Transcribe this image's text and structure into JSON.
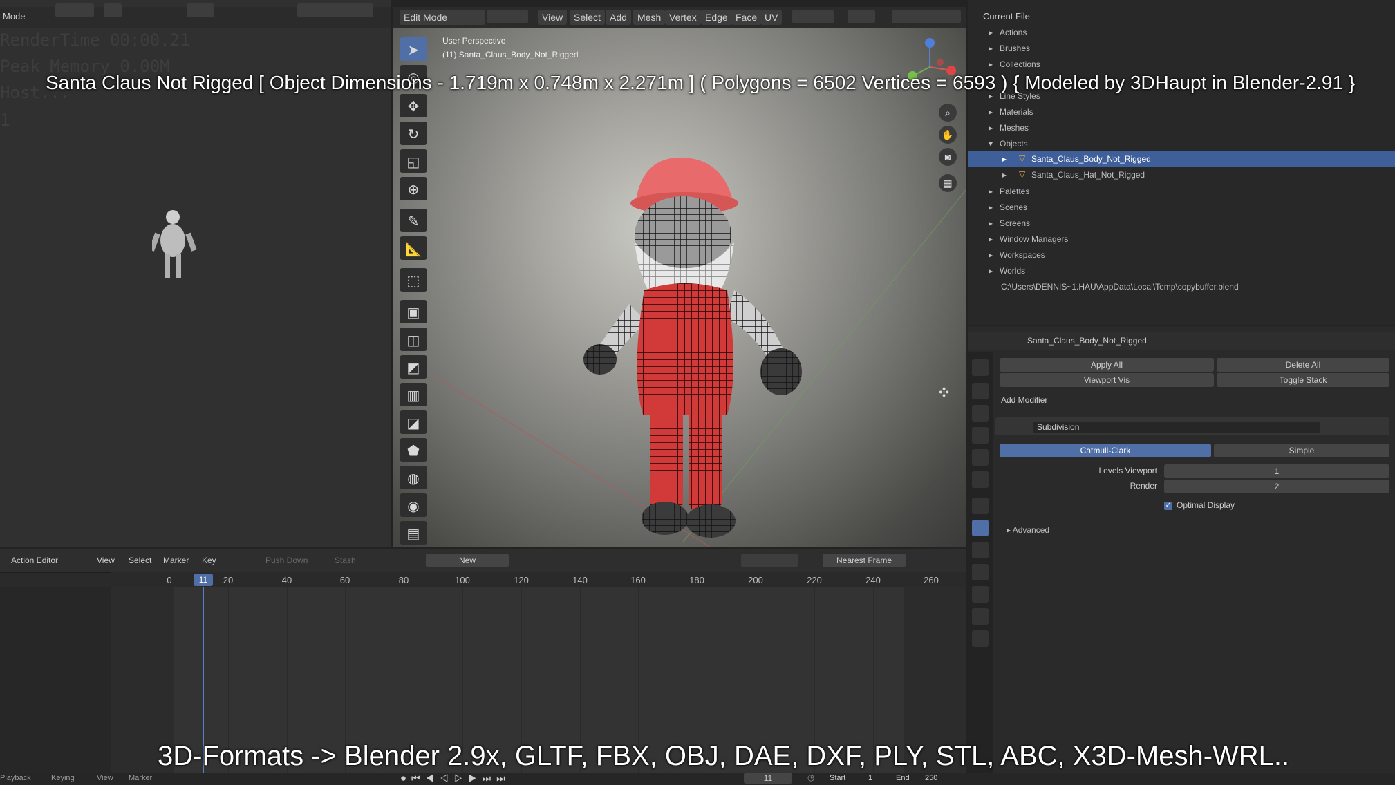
{
  "left_panel": {
    "mode_label": "Mode",
    "stats": [
      "RenderTime 00:00.21",
      "Peak Memory 0.00M",
      "Host..."
    ],
    "stat_index": "1"
  },
  "viewport": {
    "mode": "Edit Mode",
    "menus": [
      "View",
      "Select",
      "Add",
      "Mesh",
      "Vertex",
      "Edge",
      "Face",
      "UV"
    ],
    "perspective": "User Perspective",
    "object": "(11) Santa_Claus_Body_Not_Rigged"
  },
  "outliner": {
    "root": "Current File",
    "items": [
      {
        "label": "Actions",
        "indent": 1
      },
      {
        "label": "Brushes",
        "indent": 1
      },
      {
        "label": "Collections",
        "indent": 1
      },
      {
        "label": "Line Styles",
        "indent": 1
      },
      {
        "label": "Materials",
        "indent": 1
      },
      {
        "label": "Meshes",
        "indent": 1
      },
      {
        "label": "Objects",
        "indent": 1
      },
      {
        "label": "Santa_Claus_Body_Not_Rigged",
        "indent": 2,
        "selected": true
      },
      {
        "label": "Santa_Claus_Hat_Not_Rigged",
        "indent": 2
      },
      {
        "label": "Palettes",
        "indent": 1
      },
      {
        "label": "Scenes",
        "indent": 1
      },
      {
        "label": "Screens",
        "indent": 1
      },
      {
        "label": "Window Managers",
        "indent": 1
      },
      {
        "label": "Workspaces",
        "indent": 1
      },
      {
        "label": "Worlds",
        "indent": 1
      }
    ],
    "path": "C:\\Users\\DENNIS~1.HAU\\AppData\\Local\\Temp\\copybuffer.blend"
  },
  "properties": {
    "object_name": "Santa_Claus_Body_Not_Rigged",
    "apply_all": "Apply All",
    "delete_all": "Delete All",
    "viewport_vis": "Viewport Vis",
    "toggle_stack": "Toggle Stack",
    "add_modifier": "Add Modifier",
    "modifier_name": "Subdivision",
    "catmull": "Catmull-Clark",
    "simple": "Simple",
    "levels_viewport_label": "Levels Viewport",
    "levels_viewport_value": "1",
    "render_label": "Render",
    "render_value": "2",
    "optimal_display": "Optimal Display",
    "advanced": "Advanced"
  },
  "timeline": {
    "editor": "Action Editor",
    "menus": [
      "View",
      "Select",
      "Marker",
      "Key"
    ],
    "push_down": "Push Down",
    "stash": "Stash",
    "new_label": "New",
    "snap": "Nearest Frame",
    "current_frame": "11",
    "ticks": [
      "0",
      "20",
      "40",
      "60",
      "80",
      "100",
      "120",
      "140",
      "160",
      "180",
      "200",
      "220",
      "240",
      "260"
    ],
    "footer": [
      "Playback",
      "Keying",
      "View",
      "Marker"
    ],
    "start_label": "Start",
    "start_value": "1",
    "end_label": "End",
    "end_value": "250",
    "frame_field": "11"
  },
  "captions": {
    "top": "Santa Claus Not Rigged [ Object Dimensions -  1.719m x 0.748m x 2.271m ] ( Polygons = 6502  Vertices = 6593 ) { Modeled by 3DHaupt in Blender-2.91 }",
    "bottom": "3D-Formats -> Blender 2.9x, GLTF, FBX, OBJ, DAE, DXF, PLY, STL, ABC, X3D-Mesh-WRL.."
  },
  "colors": {
    "accent": "#4f6fa6",
    "santa_red": "#d23a3a",
    "playhead": "#5b7fc7"
  },
  "icons": [
    "select-box-icon",
    "cursor-icon",
    "move-icon",
    "rotate-icon",
    "scale-icon",
    "transform-icon",
    "annotate-icon",
    "measure-icon",
    "add-cube-icon",
    "extrude-icon",
    "inset-icon",
    "bevel-icon",
    "loop-cut-icon",
    "knife-icon",
    "poly-build-icon",
    "spin-icon",
    "smooth-icon",
    "shrink-icon"
  ]
}
